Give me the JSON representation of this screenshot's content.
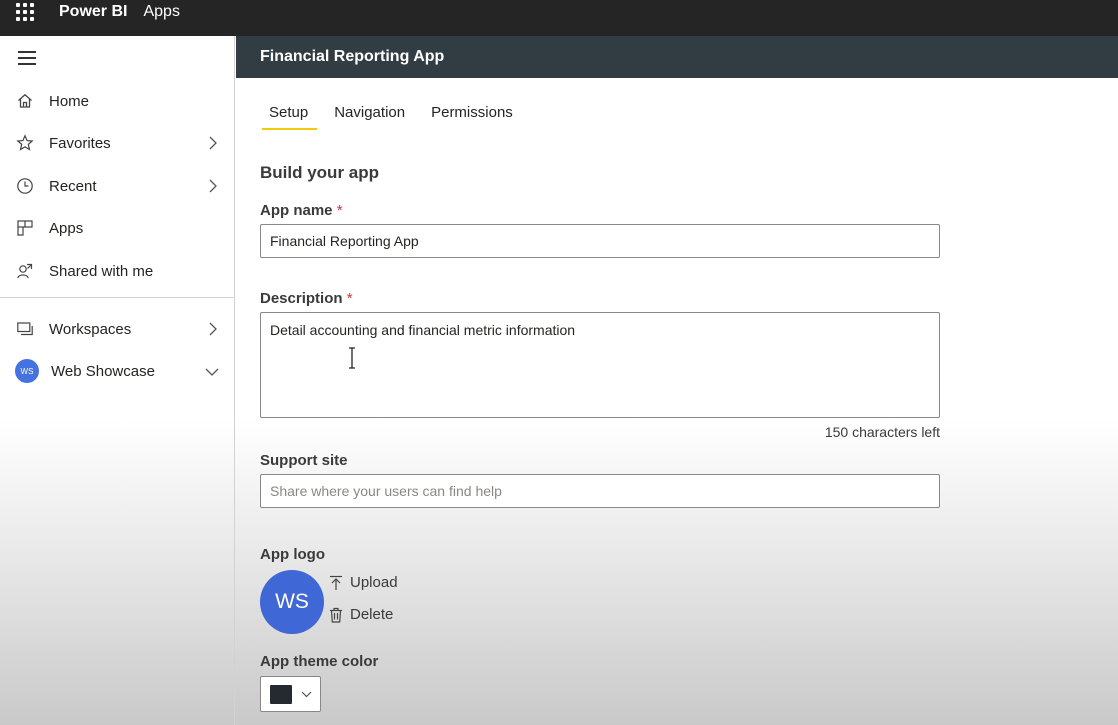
{
  "topbar": {
    "brand": "Power BI",
    "section": "Apps"
  },
  "sidebar": {
    "items": [
      {
        "label": "Home",
        "icon": "home-icon"
      },
      {
        "label": "Favorites",
        "icon": "star-icon",
        "has_chevron": true
      },
      {
        "label": "Recent",
        "icon": "clock-icon",
        "has_chevron": true
      },
      {
        "label": "Apps",
        "icon": "apps-icon"
      },
      {
        "label": "Shared with me",
        "icon": "shared-icon"
      },
      {
        "label": "Workspaces",
        "icon": "workspaces-icon",
        "has_chevron": true
      },
      {
        "label": "Web Showcase",
        "avatar": "WS",
        "chevron": "down"
      }
    ]
  },
  "app": {
    "title": "Financial Reporting App",
    "tabs": [
      "Setup",
      "Navigation",
      "Permissions"
    ],
    "active_tab": "Setup",
    "section_title": "Build your app",
    "app_name": {
      "label": "App name",
      "required_mark": "*",
      "value": "Financial Reporting App"
    },
    "description": {
      "label": "Description",
      "required_mark": "*",
      "value": "Detail accounting and financial metric information",
      "chars_left": "150 characters left"
    },
    "support_site": {
      "label": "Support site",
      "placeholder": "Share where your users can find help"
    },
    "logo": {
      "label": "App logo",
      "initials": "WS",
      "upload_label": "Upload",
      "delete_label": "Delete"
    },
    "theme": {
      "label": "App theme color",
      "color": "#252a30"
    }
  },
  "colors": {
    "topbar": "#252525",
    "app_header": "#323c43",
    "tab_underline": "#f2c811",
    "avatar": "#3f67d6",
    "required": "#d13438"
  }
}
